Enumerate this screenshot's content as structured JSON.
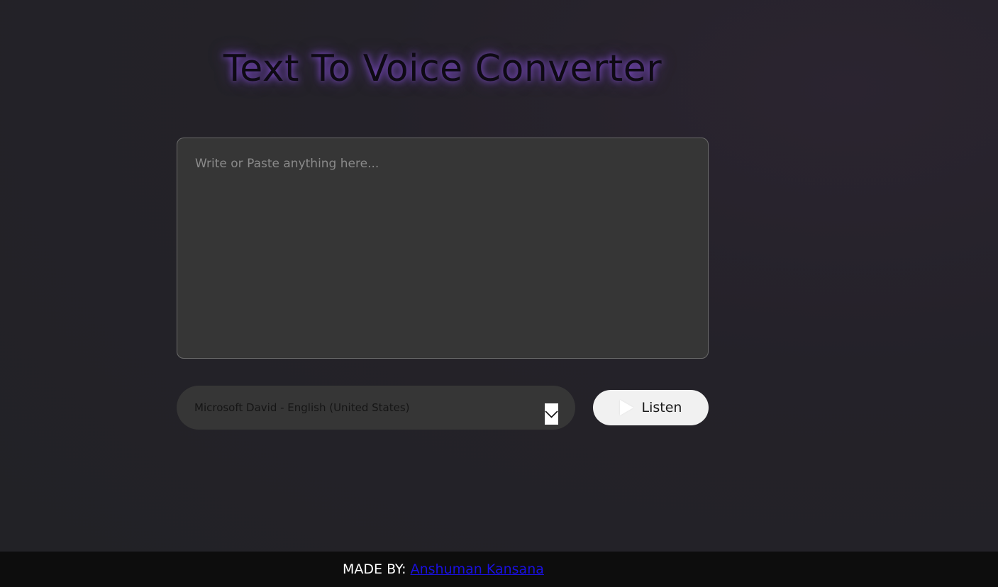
{
  "header": {
    "title": "Text To Voice Converter"
  },
  "editor": {
    "placeholder": "Write or Paste anything here...",
    "value": ""
  },
  "voice_select": {
    "selected": "Microsoft David - English (United States)",
    "arrow_icon": "chevron-down-icon"
  },
  "listen_button": {
    "label": "Listen",
    "icon": "play-icon"
  },
  "footer": {
    "made_by_label": "MADE BY:",
    "author_link": "Anshuman Kansana"
  },
  "colors": {
    "title_glow": "#9a5cf0",
    "panel": "#363636",
    "button_bg": "#f1f1f1",
    "footer_bg": "#0d0d0d",
    "link": "#1a10e0"
  }
}
